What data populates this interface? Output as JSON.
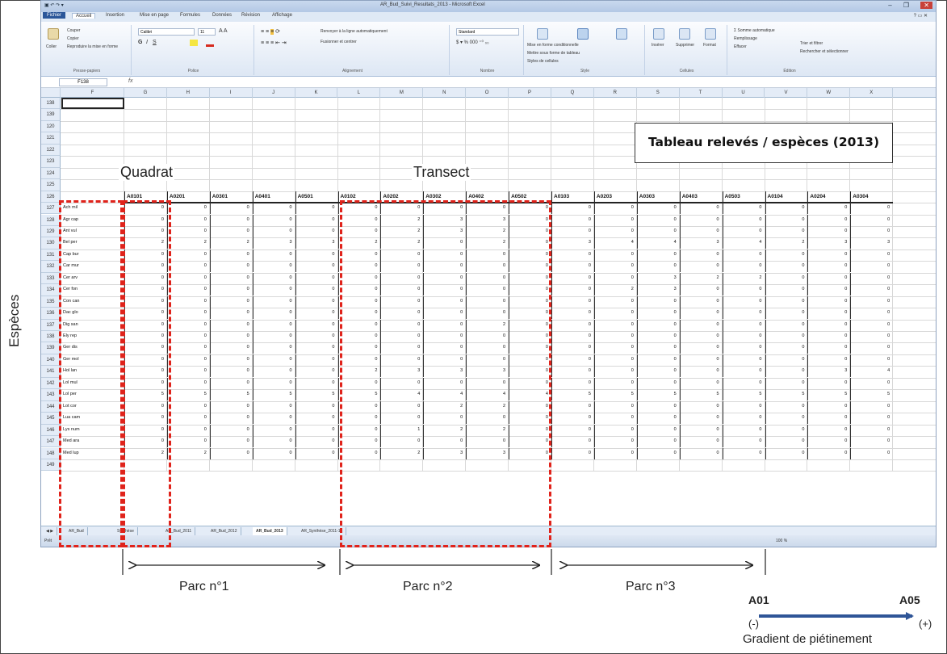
{
  "excel": {
    "window_title": "AR_Bud_Suivi_Resultats_2013 - Microsoft Excel",
    "ribbon_tabs": [
      "Fichier",
      "Accueil",
      "Insertion",
      "Mise en page",
      "Formules",
      "Données",
      "Révision",
      "Affichage"
    ],
    "ribbon": {
      "paste": "Coller",
      "cut": "Couper",
      "copy": "Copier",
      "format_painter": "Reproduire la mise en forme",
      "clipboard": "Presse-papiers",
      "font_name": "Calibri",
      "font_size": "11",
      "font_group": "Police",
      "wrap_text": "Renvoyer à la ligne automatiquement",
      "merge_center": "Fusionner et centrer",
      "alignment_group": "Alignement",
      "number_format": "Standard",
      "number_group": "Nombre",
      "conditional_formatting": "Mise en forme conditionnelle",
      "format_as_table": "Mettre sous forme de tableau",
      "cell_styles": "Styles de cellules",
      "styles_group": "Style",
      "insert": "Insérer",
      "delete": "Supprimer",
      "format": "Format",
      "cells_group": "Cellules",
      "autosum": "Somme automatique",
      "fill": "Remplissage",
      "clear": "Effacer",
      "sort_filter": "Trier et filtrer",
      "find_select": "Rechercher et sélectionner",
      "editing_group": "Édition"
    },
    "name_box": "F138",
    "fx": "fx",
    "columns": [
      "F",
      "G",
      "H",
      "I",
      "J",
      "K",
      "L",
      "M",
      "N",
      "O",
      "P",
      "Q",
      "R",
      "S",
      "T",
      "U",
      "V",
      "W",
      "X"
    ],
    "rows": [
      "138",
      "139",
      "120",
      "121",
      "122",
      "123",
      "124",
      "125",
      "126",
      "127",
      "128",
      "129",
      "130",
      "131",
      "132",
      "133",
      "134",
      "135",
      "136",
      "137",
      "138",
      "139",
      "140",
      "141",
      "142",
      "143",
      "144",
      "145",
      "146",
      "147",
      "148",
      "149"
    ],
    "headers": [
      "A0101",
      "A0201",
      "A0301",
      "A0401",
      "A0501",
      "A0102",
      "A0202",
      "A0302",
      "A0402",
      "A0502",
      "A0103",
      "A0203",
      "A0303",
      "A0403",
      "A0503",
      "A0104",
      "A0204",
      "A0304"
    ],
    "species": [
      {
        "name": "Ach mil",
        "values": [
          "0",
          "0",
          "0",
          "0",
          "0",
          "0",
          "0",
          "0",
          "0",
          "0",
          "0",
          "0",
          "0",
          "0",
          "0",
          "0",
          "0",
          "0"
        ]
      },
      {
        "name": "Agr cap",
        "values": [
          "0",
          "0",
          "0",
          "0",
          "0",
          "0",
          "2",
          "3",
          "3",
          "0",
          "0",
          "0",
          "0",
          "0",
          "0",
          "0",
          "0",
          "0"
        ]
      },
      {
        "name": "Ant vul",
        "values": [
          "0",
          "0",
          "0",
          "0",
          "0",
          "0",
          "2",
          "3",
          "2",
          "0",
          "0",
          "0",
          "0",
          "0",
          "0",
          "0",
          "0",
          "0"
        ]
      },
      {
        "name": "Bel per",
        "values": [
          "2",
          "2",
          "2",
          "3",
          "3",
          "2",
          "2",
          "0",
          "2",
          "0",
          "3",
          "4",
          "4",
          "3",
          "4",
          "2",
          "3",
          "3"
        ]
      },
      {
        "name": "Cap bur",
        "values": [
          "0",
          "0",
          "0",
          "0",
          "0",
          "0",
          "0",
          "0",
          "0",
          "0",
          "0",
          "0",
          "0",
          "0",
          "0",
          "0",
          "0",
          "0"
        ]
      },
      {
        "name": "Car mur",
        "values": [
          "0",
          "0",
          "0",
          "0",
          "0",
          "0",
          "0",
          "0",
          "0",
          "0",
          "0",
          "0",
          "0",
          "0",
          "0",
          "0",
          "0",
          "0"
        ]
      },
      {
        "name": "Cer arv",
        "values": [
          "0",
          "0",
          "0",
          "0",
          "0",
          "0",
          "0",
          "0",
          "0",
          "0",
          "0",
          "0",
          "3",
          "2",
          "2",
          "0",
          "0",
          "0"
        ]
      },
      {
        "name": "Cer fon",
        "values": [
          "0",
          "0",
          "0",
          "0",
          "0",
          "0",
          "0",
          "0",
          "0",
          "0",
          "0",
          "2",
          "3",
          "0",
          "0",
          "0",
          "0",
          "0"
        ]
      },
      {
        "name": "Con can",
        "values": [
          "0",
          "0",
          "0",
          "0",
          "0",
          "0",
          "0",
          "0",
          "0",
          "0",
          "0",
          "0",
          "0",
          "0",
          "0",
          "0",
          "0",
          "0"
        ]
      },
      {
        "name": "Dac glo",
        "values": [
          "0",
          "0",
          "0",
          "0",
          "0",
          "0",
          "0",
          "0",
          "0",
          "0",
          "0",
          "0",
          "0",
          "0",
          "0",
          "0",
          "0",
          "0"
        ]
      },
      {
        "name": "Dig san",
        "values": [
          "0",
          "0",
          "0",
          "0",
          "0",
          "0",
          "0",
          "0",
          "2",
          "0",
          "0",
          "0",
          "0",
          "0",
          "0",
          "0",
          "0",
          "0"
        ]
      },
      {
        "name": "Ely rep",
        "values": [
          "0",
          "0",
          "0",
          "0",
          "0",
          "0",
          "0",
          "0",
          "0",
          "0",
          "0",
          "0",
          "0",
          "0",
          "0",
          "0",
          "0",
          "0"
        ]
      },
      {
        "name": "Ger dis",
        "values": [
          "0",
          "0",
          "0",
          "0",
          "0",
          "0",
          "0",
          "0",
          "0",
          "0",
          "0",
          "0",
          "0",
          "0",
          "0",
          "0",
          "0",
          "0"
        ]
      },
      {
        "name": "Ger mol",
        "values": [
          "0",
          "0",
          "0",
          "0",
          "0",
          "0",
          "0",
          "0",
          "0",
          "0",
          "0",
          "0",
          "0",
          "0",
          "0",
          "0",
          "0",
          "0"
        ]
      },
      {
        "name": "Hol lan",
        "values": [
          "0",
          "0",
          "0",
          "0",
          "0",
          "2",
          "3",
          "3",
          "3",
          "0",
          "0",
          "0",
          "0",
          "0",
          "0",
          "0",
          "3",
          "4"
        ]
      },
      {
        "name": "Lol mul",
        "values": [
          "0",
          "0",
          "0",
          "0",
          "0",
          "0",
          "0",
          "0",
          "0",
          "0",
          "0",
          "0",
          "0",
          "0",
          "0",
          "0",
          "0",
          "0"
        ]
      },
      {
        "name": "Lol per",
        "values": [
          "5",
          "5",
          "5",
          "5",
          "5",
          "5",
          "4",
          "4",
          "4",
          "4",
          "5",
          "5",
          "5",
          "5",
          "5",
          "5",
          "5",
          "5"
        ]
      },
      {
        "name": "Lot cor",
        "values": [
          "0",
          "0",
          "0",
          "0",
          "0",
          "0",
          "0",
          "2",
          "2",
          "0",
          "0",
          "0",
          "0",
          "0",
          "0",
          "0",
          "0",
          "0"
        ]
      },
      {
        "name": "Lua cam",
        "values": [
          "0",
          "0",
          "0",
          "0",
          "0",
          "0",
          "0",
          "0",
          "0",
          "0",
          "0",
          "0",
          "0",
          "0",
          "0",
          "0",
          "0",
          "0"
        ]
      },
      {
        "name": "Lys num",
        "values": [
          "0",
          "0",
          "0",
          "0",
          "0",
          "0",
          "1",
          "2",
          "2",
          "0",
          "0",
          "0",
          "0",
          "0",
          "0",
          "0",
          "0",
          "0"
        ]
      },
      {
        "name": "Med ara",
        "values": [
          "0",
          "0",
          "0",
          "0",
          "0",
          "0",
          "0",
          "0",
          "0",
          "0",
          "0",
          "0",
          "0",
          "0",
          "0",
          "0",
          "0",
          "0"
        ]
      },
      {
        "name": "Med lup",
        "values": [
          "2",
          "2",
          "0",
          "0",
          "0",
          "0",
          "2",
          "3",
          "3",
          "0",
          "0",
          "0",
          "0",
          "0",
          "0",
          "0",
          "0",
          "0"
        ]
      }
    ],
    "sheet_tabs": [
      "AR_Bud",
      "Synthèse",
      "AR_Bud_2011",
      "AR_Bud_2012",
      "AR_Bud_2013",
      "AR_Synthèse_2011-13"
    ],
    "status_ready": "Prêt",
    "zoom": "100 %"
  },
  "annotations": {
    "table_title": "Tableau relevés / espèces (2013)",
    "quadrat": "Quadrat",
    "transect": "Transect",
    "species_axis": "Espèces",
    "parc1": "Parc n°1",
    "parc2": "Parc n°2",
    "parc3": "Parc n°3",
    "gradient_start": "A01",
    "gradient_end": "A05",
    "gradient_minus": "(-)",
    "gradient_plus": "(+)",
    "gradient_label": "Gradient de piétinement"
  },
  "colors": {
    "dash_red": "#e0231b",
    "gradient_arrow": "#2f5597",
    "ribbon_blue": "#2a5699"
  }
}
